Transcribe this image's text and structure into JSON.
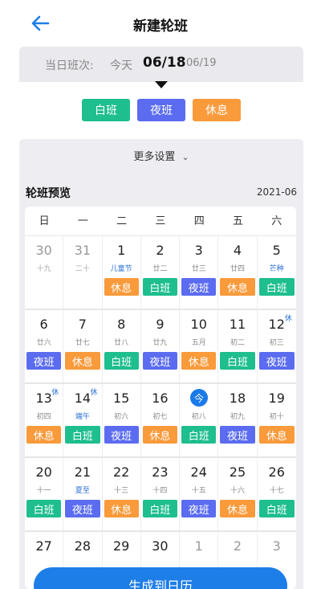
{
  "header": {
    "title": "新建轮班"
  },
  "date_strip": {
    "label": "当日班次:",
    "today": "今天",
    "active": "06/18",
    "next": "06/19"
  },
  "shift_options": {
    "day": "白班",
    "night": "夜班",
    "rest": "休息"
  },
  "settings": {
    "more": "更多设置"
  },
  "preview": {
    "title": "轮班预览",
    "month": "2021-06"
  },
  "weekdays": [
    "日",
    "一",
    "二",
    "三",
    "四",
    "五",
    "六"
  ],
  "weeks": [
    [
      {
        "day": "30",
        "lunar": "十九",
        "other": true
      },
      {
        "day": "31",
        "lunar": "二十",
        "other": true
      },
      {
        "day": "1",
        "lunar": "儿童节",
        "festival": true,
        "shift": "休息",
        "type": "rest"
      },
      {
        "day": "2",
        "lunar": "廿二",
        "shift": "白班",
        "type": "day"
      },
      {
        "day": "3",
        "lunar": "廿三",
        "shift": "夜班",
        "type": "night"
      },
      {
        "day": "4",
        "lunar": "廿四",
        "shift": "休息",
        "type": "rest"
      },
      {
        "day": "5",
        "lunar": "芒种",
        "festival": true,
        "shift": "白班",
        "type": "day"
      }
    ],
    [
      {
        "day": "6",
        "lunar": "廿六",
        "shift": "夜班",
        "type": "night"
      },
      {
        "day": "7",
        "lunar": "廿七",
        "shift": "休息",
        "type": "rest"
      },
      {
        "day": "8",
        "lunar": "廿八",
        "shift": "白班",
        "type": "day"
      },
      {
        "day": "9",
        "lunar": "廿九",
        "shift": "夜班",
        "type": "night"
      },
      {
        "day": "10",
        "lunar": "五月",
        "shift": "休息",
        "type": "rest"
      },
      {
        "day": "11",
        "lunar": "初二",
        "shift": "白班",
        "type": "day"
      },
      {
        "day": "12",
        "lunar": "初三",
        "holiday": "休",
        "shift": "夜班",
        "type": "night"
      }
    ],
    [
      {
        "day": "13",
        "lunar": "初四",
        "holiday": "休",
        "shift": "休息",
        "type": "rest"
      },
      {
        "day": "14",
        "lunar": "端午",
        "festival": true,
        "holiday": "休",
        "shift": "白班",
        "type": "day"
      },
      {
        "day": "15",
        "lunar": "初六",
        "shift": "夜班",
        "type": "night"
      },
      {
        "day": "16",
        "lunar": "初七",
        "shift": "休息",
        "type": "rest"
      },
      {
        "day": "今",
        "lunar": "初八",
        "today": true,
        "shift": "白班",
        "type": "day"
      },
      {
        "day": "18",
        "lunar": "初九",
        "shift": "夜班",
        "type": "night"
      },
      {
        "day": "19",
        "lunar": "初十",
        "shift": "休息",
        "type": "rest"
      }
    ],
    [
      {
        "day": "20",
        "lunar": "十一",
        "shift": "白班",
        "type": "day"
      },
      {
        "day": "21",
        "lunar": "夏至",
        "festival": true,
        "shift": "夜班",
        "type": "night"
      },
      {
        "day": "22",
        "lunar": "十三",
        "shift": "休息",
        "type": "rest"
      },
      {
        "day": "23",
        "lunar": "十四",
        "shift": "白班",
        "type": "day"
      },
      {
        "day": "24",
        "lunar": "十五",
        "shift": "夜班",
        "type": "night"
      },
      {
        "day": "25",
        "lunar": "十六",
        "shift": "休息",
        "type": "rest"
      },
      {
        "day": "26",
        "lunar": "十七",
        "shift": "白班",
        "type": "day"
      }
    ],
    [
      {
        "day": "27",
        "lunar": ""
      },
      {
        "day": "28",
        "lunar": ""
      },
      {
        "day": "29",
        "lunar": ""
      },
      {
        "day": "30",
        "lunar": ""
      },
      {
        "day": "1",
        "lunar": "",
        "other": true
      },
      {
        "day": "2",
        "lunar": "",
        "other": true
      },
      {
        "day": "3",
        "lunar": "",
        "other": true
      }
    ]
  ],
  "actions": {
    "generate": "生成到日历"
  },
  "colors": {
    "day": "#1fbe8f",
    "night": "#5b6cf0",
    "rest": "#f99a3b",
    "primary": "#1e7ee8"
  }
}
